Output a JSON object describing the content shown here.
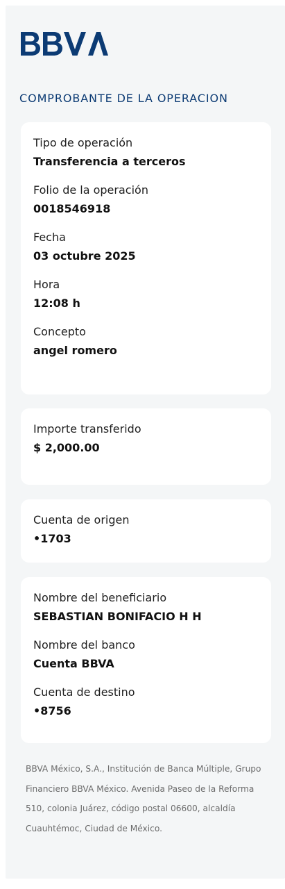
{
  "brand": {
    "name": "BBVA",
    "logo_icon": "bbva-logo-icon",
    "color": "#0c3b74"
  },
  "receipt": {
    "title": "COMPROBANTE DE LA OPERACION"
  },
  "details": {
    "operation_type": {
      "label": "Tipo de operación",
      "value": "Transferencia a terceros"
    },
    "folio": {
      "label": "Folio de la operación",
      "value": "0018546918"
    },
    "date": {
      "label": "Fecha",
      "value": "03 octubre 2025"
    },
    "time": {
      "label": "Hora",
      "value": "12:08 h"
    },
    "concept": {
      "label": "Concepto",
      "value": "angel romero"
    }
  },
  "amount": {
    "label": "Importe transferido",
    "value": "$ 2,000.00"
  },
  "origin": {
    "label": "Cuenta de origen",
    "value": "•1703"
  },
  "beneficiary": {
    "name": {
      "label": "Nombre del beneficiario",
      "value": "SEBASTIAN BONIFACIO H H"
    },
    "bank": {
      "label": "Nombre del banco",
      "value": "Cuenta BBVA"
    },
    "destination": {
      "label": "Cuenta de destino",
      "value": "•8756"
    }
  },
  "footer": {
    "disclaimer": "BBVA México, S.A., Institución de Banca Múltiple, Grupo Financiero BBVA México. Avenida Paseo de la Reforma 510, colonia Juárez, código postal 06600, alcaldía Cuauhtémoc, Ciudad de México."
  },
  "colors": {
    "page_background": "#f4f6f7",
    "card_background": "#ffffff",
    "title": "#0c3b74",
    "disclaimer": "#6b6b6b"
  }
}
